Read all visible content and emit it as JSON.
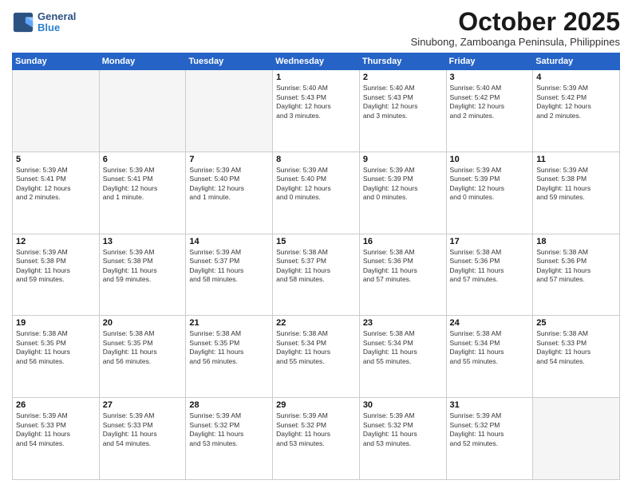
{
  "header": {
    "logo_line1": "General",
    "logo_line2": "Blue",
    "month": "October 2025",
    "location": "Sinubong, Zamboanga Peninsula, Philippines"
  },
  "days_of_week": [
    "Sunday",
    "Monday",
    "Tuesday",
    "Wednesday",
    "Thursday",
    "Friday",
    "Saturday"
  ],
  "weeks": [
    [
      {
        "day": "",
        "empty": true
      },
      {
        "day": "",
        "empty": true
      },
      {
        "day": "",
        "empty": true
      },
      {
        "day": "1",
        "lines": [
          "Sunrise: 5:40 AM",
          "Sunset: 5:43 PM",
          "Daylight: 12 hours",
          "and 3 minutes."
        ]
      },
      {
        "day": "2",
        "lines": [
          "Sunrise: 5:40 AM",
          "Sunset: 5:43 PM",
          "Daylight: 12 hours",
          "and 3 minutes."
        ]
      },
      {
        "day": "3",
        "lines": [
          "Sunrise: 5:40 AM",
          "Sunset: 5:42 PM",
          "Daylight: 12 hours",
          "and 2 minutes."
        ]
      },
      {
        "day": "4",
        "lines": [
          "Sunrise: 5:39 AM",
          "Sunset: 5:42 PM",
          "Daylight: 12 hours",
          "and 2 minutes."
        ]
      }
    ],
    [
      {
        "day": "5",
        "lines": [
          "Sunrise: 5:39 AM",
          "Sunset: 5:41 PM",
          "Daylight: 12 hours",
          "and 2 minutes."
        ]
      },
      {
        "day": "6",
        "lines": [
          "Sunrise: 5:39 AM",
          "Sunset: 5:41 PM",
          "Daylight: 12 hours",
          "and 1 minute."
        ]
      },
      {
        "day": "7",
        "lines": [
          "Sunrise: 5:39 AM",
          "Sunset: 5:40 PM",
          "Daylight: 12 hours",
          "and 1 minute."
        ]
      },
      {
        "day": "8",
        "lines": [
          "Sunrise: 5:39 AM",
          "Sunset: 5:40 PM",
          "Daylight: 12 hours",
          "and 0 minutes."
        ]
      },
      {
        "day": "9",
        "lines": [
          "Sunrise: 5:39 AM",
          "Sunset: 5:39 PM",
          "Daylight: 12 hours",
          "and 0 minutes."
        ]
      },
      {
        "day": "10",
        "lines": [
          "Sunrise: 5:39 AM",
          "Sunset: 5:39 PM",
          "Daylight: 12 hours",
          "and 0 minutes."
        ]
      },
      {
        "day": "11",
        "lines": [
          "Sunrise: 5:39 AM",
          "Sunset: 5:38 PM",
          "Daylight: 11 hours",
          "and 59 minutes."
        ]
      }
    ],
    [
      {
        "day": "12",
        "lines": [
          "Sunrise: 5:39 AM",
          "Sunset: 5:38 PM",
          "Daylight: 11 hours",
          "and 59 minutes."
        ]
      },
      {
        "day": "13",
        "lines": [
          "Sunrise: 5:39 AM",
          "Sunset: 5:38 PM",
          "Daylight: 11 hours",
          "and 59 minutes."
        ]
      },
      {
        "day": "14",
        "lines": [
          "Sunrise: 5:39 AM",
          "Sunset: 5:37 PM",
          "Daylight: 11 hours",
          "and 58 minutes."
        ]
      },
      {
        "day": "15",
        "lines": [
          "Sunrise: 5:38 AM",
          "Sunset: 5:37 PM",
          "Daylight: 11 hours",
          "and 58 minutes."
        ]
      },
      {
        "day": "16",
        "lines": [
          "Sunrise: 5:38 AM",
          "Sunset: 5:36 PM",
          "Daylight: 11 hours",
          "and 57 minutes."
        ]
      },
      {
        "day": "17",
        "lines": [
          "Sunrise: 5:38 AM",
          "Sunset: 5:36 PM",
          "Daylight: 11 hours",
          "and 57 minutes."
        ]
      },
      {
        "day": "18",
        "lines": [
          "Sunrise: 5:38 AM",
          "Sunset: 5:36 PM",
          "Daylight: 11 hours",
          "and 57 minutes."
        ]
      }
    ],
    [
      {
        "day": "19",
        "lines": [
          "Sunrise: 5:38 AM",
          "Sunset: 5:35 PM",
          "Daylight: 11 hours",
          "and 56 minutes."
        ]
      },
      {
        "day": "20",
        "lines": [
          "Sunrise: 5:38 AM",
          "Sunset: 5:35 PM",
          "Daylight: 11 hours",
          "and 56 minutes."
        ]
      },
      {
        "day": "21",
        "lines": [
          "Sunrise: 5:38 AM",
          "Sunset: 5:35 PM",
          "Daylight: 11 hours",
          "and 56 minutes."
        ]
      },
      {
        "day": "22",
        "lines": [
          "Sunrise: 5:38 AM",
          "Sunset: 5:34 PM",
          "Daylight: 11 hours",
          "and 55 minutes."
        ]
      },
      {
        "day": "23",
        "lines": [
          "Sunrise: 5:38 AM",
          "Sunset: 5:34 PM",
          "Daylight: 11 hours",
          "and 55 minutes."
        ]
      },
      {
        "day": "24",
        "lines": [
          "Sunrise: 5:38 AM",
          "Sunset: 5:34 PM",
          "Daylight: 11 hours",
          "and 55 minutes."
        ]
      },
      {
        "day": "25",
        "lines": [
          "Sunrise: 5:38 AM",
          "Sunset: 5:33 PM",
          "Daylight: 11 hours",
          "and 54 minutes."
        ]
      }
    ],
    [
      {
        "day": "26",
        "lines": [
          "Sunrise: 5:39 AM",
          "Sunset: 5:33 PM",
          "Daylight: 11 hours",
          "and 54 minutes."
        ]
      },
      {
        "day": "27",
        "lines": [
          "Sunrise: 5:39 AM",
          "Sunset: 5:33 PM",
          "Daylight: 11 hours",
          "and 54 minutes."
        ]
      },
      {
        "day": "28",
        "lines": [
          "Sunrise: 5:39 AM",
          "Sunset: 5:32 PM",
          "Daylight: 11 hours",
          "and 53 minutes."
        ]
      },
      {
        "day": "29",
        "lines": [
          "Sunrise: 5:39 AM",
          "Sunset: 5:32 PM",
          "Daylight: 11 hours",
          "and 53 minutes."
        ]
      },
      {
        "day": "30",
        "lines": [
          "Sunrise: 5:39 AM",
          "Sunset: 5:32 PM",
          "Daylight: 11 hours",
          "and 53 minutes."
        ]
      },
      {
        "day": "31",
        "lines": [
          "Sunrise: 5:39 AM",
          "Sunset: 5:32 PM",
          "Daylight: 11 hours",
          "and 52 minutes."
        ]
      },
      {
        "day": "",
        "empty": true
      }
    ]
  ]
}
